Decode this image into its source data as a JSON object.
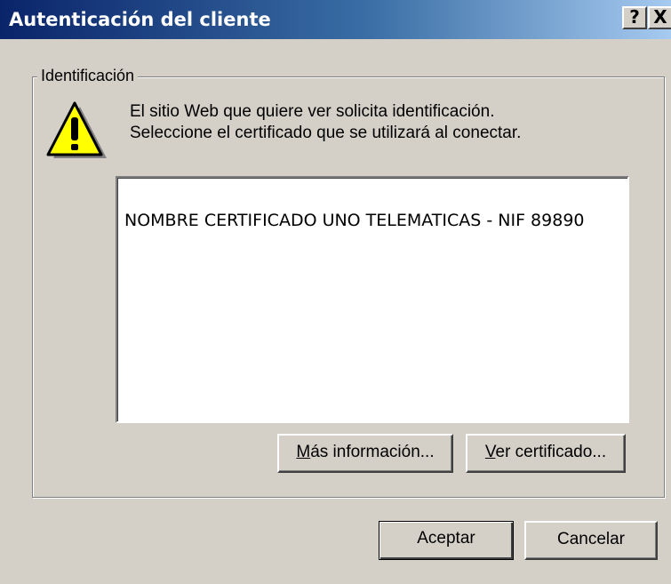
{
  "window": {
    "title": "Autenticación del cliente",
    "help_label": "?",
    "close_label": "X"
  },
  "group": {
    "label": "Identificación"
  },
  "message": {
    "line1": "El sitio Web que quiere ver solicita identificación.",
    "line2": "Seleccione el certificado que se utilizará al conectar."
  },
  "certificates": [
    "NOMBRE CERTIFICADO UNO TELEMATICAS - NIF 89890"
  ],
  "buttons": {
    "more_info": {
      "underline": "M",
      "rest": "ás información..."
    },
    "view_cert": {
      "underline": "V",
      "rest": "er certificado..."
    },
    "ok": "Aceptar",
    "cancel": "Cancelar"
  },
  "icons": {
    "warning": "warning-triangle-icon"
  },
  "colors": {
    "titlebar_start": "#0a246a",
    "titlebar_end": "#a6caf0",
    "dialog_bg": "#d4d0c8",
    "warning_fill": "#ffff00"
  }
}
